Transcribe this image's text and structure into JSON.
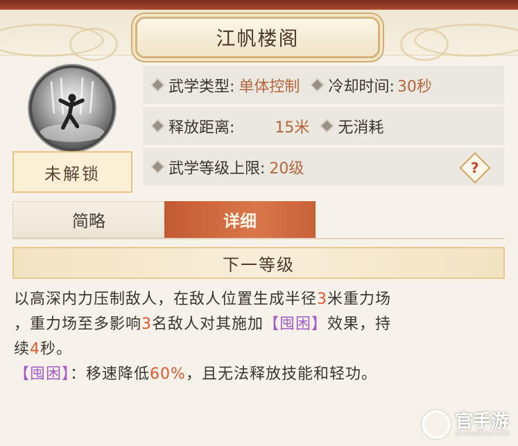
{
  "header": {
    "title": "江帆楼阁"
  },
  "skill": {
    "icon": "skill-icon-silhouette",
    "lock_status": "未解锁"
  },
  "stats": {
    "type_label": "武学类型:",
    "type_value": "单体控制",
    "cooldown_label": "冷却时间:",
    "cooldown_value": "30秒",
    "range_label": "释放距离:",
    "range_value": "15米",
    "cost_label": "无消耗",
    "level_label": "武学等级上限:",
    "level_value": "20级",
    "help_icon": "?"
  },
  "tabs": {
    "brief": "简略",
    "detail": "详细"
  },
  "section": {
    "title": "下一等级"
  },
  "description": {
    "l1a": "以高深内力压制敌人，在敌人位置生成半径",
    "l1n": "3",
    "l1b": "米重力场",
    "l2a": "，重力场至多影响",
    "l2n": "3",
    "l2b": "名敌人对其施加",
    "l2t": "【囤困】",
    "l2c": "效果，持",
    "l3a": "续",
    "l3n": "4",
    "l3b": "秒。",
    "l4t": "【囤困】",
    "l4a": "：移速降低",
    "l4n": "60%",
    "l4b": "，且无法释放技能和轻功。"
  },
  "watermark": {
    "text": "官手游",
    "sub": "GAOSHOUYOU.COM"
  },
  "colors": {
    "accent": "#b5673b",
    "highlight": "#e0582f",
    "tag": "#a45ac7",
    "tab_active": "#c25a31"
  }
}
